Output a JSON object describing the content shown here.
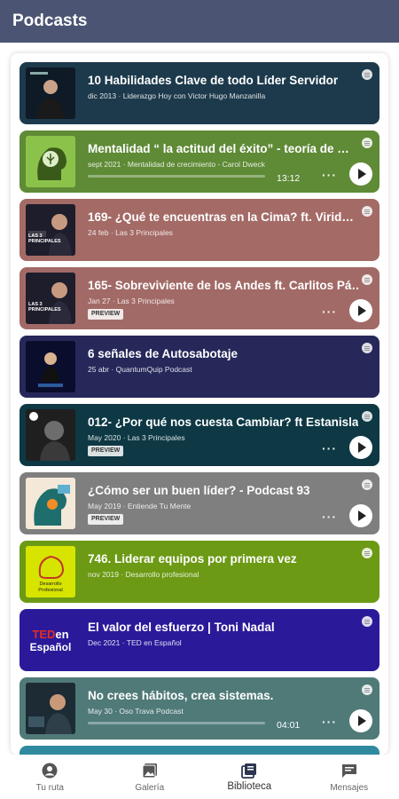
{
  "header": {
    "title": "Podcasts"
  },
  "episodes": [
    {
      "title": "10 Habilidades Clave de todo Líder Servidor",
      "subtitle": "dic 2013 · Liderazgo Hoy con Victor Hugo Manzanilla",
      "bg": "#1d3a4c"
    },
    {
      "title": "Mentalidad “ la actitud del éxito” - teoría de …",
      "subtitle": "sept 2021 · Mentalidad de crecimiento - Carol Dweck",
      "time": "13:12",
      "bg": "#5f8a36"
    },
    {
      "title": "169- ¿Qué te encuentras en la Cima? ft. Virid…",
      "subtitle": "24 feb · Las 3 Principales",
      "bg": "#a46a66"
    },
    {
      "title": "165- Sobreviviente de los Andes ft. Carlitos Pá…",
      "subtitle": "Jan 27 · Las 3 Principales",
      "badge": "PREVIEW",
      "bg": "#a26a66"
    },
    {
      "title": "6 señales de Autosabotaje",
      "subtitle": "25 abr · QuantumQuip Podcast",
      "bg": "#26285a"
    },
    {
      "title": "012- ¿Por qué nos cuesta Cambiar? ft Estanisla…",
      "subtitle": "May 2020 · Las 3 Principales",
      "badge": "PREVIEW",
      "bg": "#0d3844"
    },
    {
      "title": "¿Cómo ser un buen líder? - Podcast 93",
      "subtitle": "May 2019 · Entiende Tu Mente",
      "badge": "PREVIEW",
      "bg": "#7f7f7f"
    },
    {
      "title": "746. Liderar equipos por primera vez",
      "subtitle": "nov 2019 · Desarrollo profesional",
      "bg": "#6c9a14"
    },
    {
      "title": "El valor del esfuerzo | Toni Nadal",
      "subtitle": "Dec 2021 · TED en Español",
      "bg": "#2a1a9a"
    },
    {
      "title": "No crees hábitos, crea sistemas.",
      "subtitle": "May 30 · Oso Trava Podcast",
      "time": "04:01",
      "bg": "#4f7a78"
    }
  ],
  "thumb_texts": {
    "las3": "LAS 3 PRINCIPALES",
    "dev": "Desarrollo Profesional",
    "ted_top": "TED",
    "ted_en": "en",
    "ted_bottom": "Español"
  },
  "nav": [
    {
      "label": "Tu ruta",
      "icon": "user-circle-icon"
    },
    {
      "label": "Galería",
      "icon": "gallery-icon"
    },
    {
      "label": "Biblioteca",
      "icon": "library-icon",
      "active": true
    },
    {
      "label": "Mensajes",
      "icon": "message-icon"
    }
  ]
}
